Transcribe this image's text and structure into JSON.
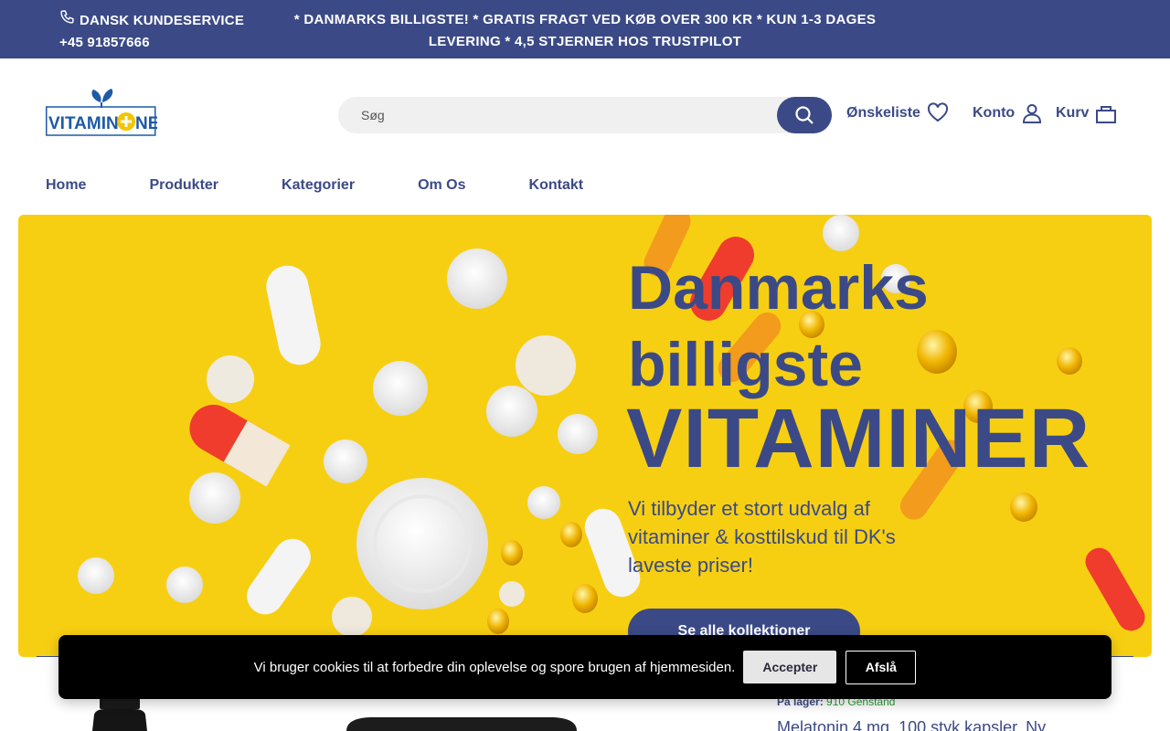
{
  "topbar": {
    "service_label": "DANSK KUNDESERVICE",
    "phone": "+45 91857666",
    "promo_line1": "* DANMARKS BILLIGSTE! * GRATIS FRAGT VED KØB OVER 300 KR * KUN 1-3 DAGES",
    "promo_line2": "LEVERING * 4,5 STJERNER HOS TRUSTPILOT"
  },
  "header": {
    "logo_text": "VITAMIN+NE",
    "search_placeholder": "Søg",
    "wishlist_label": "Ønskeliste",
    "account_label": "Konto",
    "cart_label": "Kurv"
  },
  "nav": {
    "items": [
      {
        "label": "Home"
      },
      {
        "label": "Produkter"
      },
      {
        "label": "Kategorier"
      },
      {
        "label": "Om Os"
      },
      {
        "label": "Kontakt"
      }
    ]
  },
  "hero": {
    "headline_line1": "Danmarks",
    "headline_line2": "billigste",
    "headline_big": "VITAMINER",
    "subtext": "Vi tilbyder et stort udvalg af vitaminer & kosttilskud til DK's laveste priser!",
    "cta_label": "Se alle kollektioner"
  },
  "product": {
    "stock_label": "På lager:",
    "stock_value": "910 Genstand",
    "title": "Melatonin 4 mg, 100 styk kapsler, Ny"
  },
  "cookie": {
    "message": "Vi bruger cookies til at forbedre din oplevelse og spore brugen af hjemmesiden.",
    "accept_label": "Accepter",
    "decline_label": "Afslå"
  },
  "colors": {
    "brand_blue": "#3b4a86",
    "hero_yellow": "#f7cf12",
    "stock_green": "#2a9d3a"
  },
  "icons": [
    "phone-icon",
    "search-icon",
    "heart-icon",
    "user-icon",
    "bag-icon",
    "leaf-logo-icon"
  ]
}
